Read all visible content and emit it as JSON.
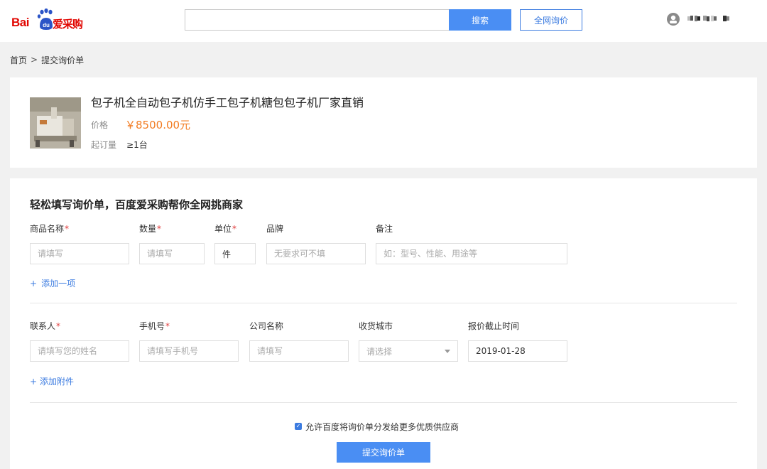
{
  "header": {
    "logo": {
      "bai": "Bai",
      "du": "du",
      "cn": "爱采购"
    },
    "search": {
      "value": "",
      "button_label": "搜索"
    },
    "inquire_button_label": "全网询价",
    "user": {
      "avatar_icon": "user-icon"
    }
  },
  "breadcrumb": {
    "home": "首页",
    "separator": ">",
    "current": "提交询价单"
  },
  "product": {
    "title": "包子机全自动包子机仿手工包子机糖包包子机厂家直销",
    "price_label": "价格",
    "price_value": "￥8500.00元",
    "moq_label": "起订量",
    "moq_value": "≥1台"
  },
  "form": {
    "title": "轻松填写询价单，百度爱采购帮你全网挑商家",
    "items": {
      "name": {
        "label": "商品名称",
        "required": "*",
        "placeholder": "请填写"
      },
      "qty": {
        "label": "数量",
        "required": "*",
        "placeholder": "请填写"
      },
      "unit": {
        "label": "单位",
        "required": "*",
        "value": "件"
      },
      "brand": {
        "label": "品牌",
        "placeholder": "无要求可不填"
      },
      "note": {
        "label": "备注",
        "placeholder": "如：型号、性能、用途等"
      },
      "add_label": "添加一项",
      "add_icon": "+"
    },
    "contact": {
      "person": {
        "label": "联系人",
        "required": "*",
        "placeholder": "请填写您的姓名"
      },
      "phone": {
        "label": "手机号",
        "required": "*",
        "placeholder": "请填写手机号"
      },
      "company": {
        "label": "公司名称",
        "placeholder": "请填写"
      },
      "city": {
        "label": "收货城市",
        "placeholder": "请选择"
      },
      "deadline": {
        "label": "报价截止时间",
        "value": "2019-01-28"
      },
      "attach_label": "+ 添加附件"
    },
    "agree_text": "允许百度将询价单分发给更多优质供应商",
    "agree_checked": true,
    "submit_label": "提交询价单"
  },
  "colors": {
    "accent": "#4a8ef3",
    "price": "#f27c22",
    "required": "#e13d3d",
    "brand_red": "#e10601"
  }
}
